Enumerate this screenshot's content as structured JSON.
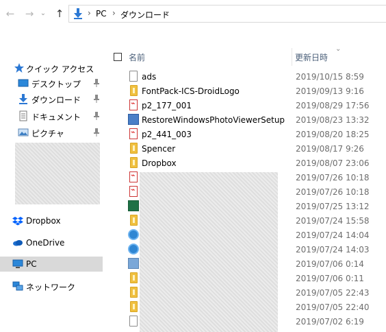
{
  "address_bar": {
    "back_icon": "arrow-left-icon",
    "forward_icon": "arrow-right-icon",
    "up_icon": "arrow-up-icon",
    "breadcrumbs": [
      "PC",
      "ダウンロード"
    ],
    "separator": "›"
  },
  "nav_pane": {
    "items": [
      {
        "label": "クイック アクセス",
        "icon": "star-icon"
      },
      {
        "label": "デスクトップ",
        "icon": "desktop-icon",
        "pinned": true
      },
      {
        "label": "ダウンロード",
        "icon": "download-icon",
        "pinned": true
      },
      {
        "label": "ドキュメント",
        "icon": "document-icon",
        "pinned": true
      },
      {
        "label": "ピクチャ",
        "icon": "pictures-icon",
        "pinned": true
      },
      {
        "label": "Dropbox",
        "icon": "dropbox-icon"
      },
      {
        "label": "OneDrive",
        "icon": "onedrive-icon"
      },
      {
        "label": "PC",
        "icon": "pc-icon",
        "selected": true
      },
      {
        "label": "ネットワーク",
        "icon": "network-icon"
      }
    ]
  },
  "columns": {
    "name": "名前",
    "date_modified": "更新日時"
  },
  "files": [
    {
      "name": "ads",
      "date": "2019/10/15 8:59",
      "icon": "file-icon"
    },
    {
      "name": "FontPack-ICS-DroidLogo",
      "date": "2019/09/13 9:16",
      "icon": "zip-folder-icon"
    },
    {
      "name": "p2_177_001",
      "date": "2019/08/29 17:56",
      "icon": "pdf-icon"
    },
    {
      "name": "RestoreWindowsPhotoViewerSetup",
      "date": "2019/08/23 13:32",
      "icon": "installer-icon"
    },
    {
      "name": "p2_441_003",
      "date": "2019/08/20 18:25",
      "icon": "pdf-icon"
    },
    {
      "name": "Spencer",
      "date": "2019/08/17 9:26",
      "icon": "zip-folder-icon"
    },
    {
      "name": "Dropbox",
      "date": "2019/08/07 23:06",
      "icon": "zip-folder-icon"
    },
    {
      "name": "",
      "date": "2019/07/26 10:18",
      "icon": "pdf-icon"
    },
    {
      "name": "",
      "date": "2019/07/26 10:18",
      "icon": "pdf-icon"
    },
    {
      "name": "",
      "date": "2019/07/25 13:12",
      "icon": "excel-icon"
    },
    {
      "name": "",
      "date": "2019/07/24 15:58",
      "icon": "zip-folder-icon"
    },
    {
      "name": "",
      "date": "2019/07/24 14:04",
      "icon": "ie-icon"
    },
    {
      "name": "",
      "date": "2019/07/24 14:03",
      "icon": "ie-icon"
    },
    {
      "name": "",
      "date": "2019/07/06 0:14",
      "icon": "image-icon"
    },
    {
      "name": "",
      "date": "2019/07/06 0:11",
      "icon": "zip-folder-icon"
    },
    {
      "name": "",
      "date": "2019/07/05 22:43",
      "icon": "zip-folder-icon"
    },
    {
      "name": "",
      "date": "2019/07/05 22:40",
      "icon": "zip-folder-icon"
    },
    {
      "name": "",
      "date": "2019/07/02 6:19",
      "icon": "file-icon"
    }
  ]
}
